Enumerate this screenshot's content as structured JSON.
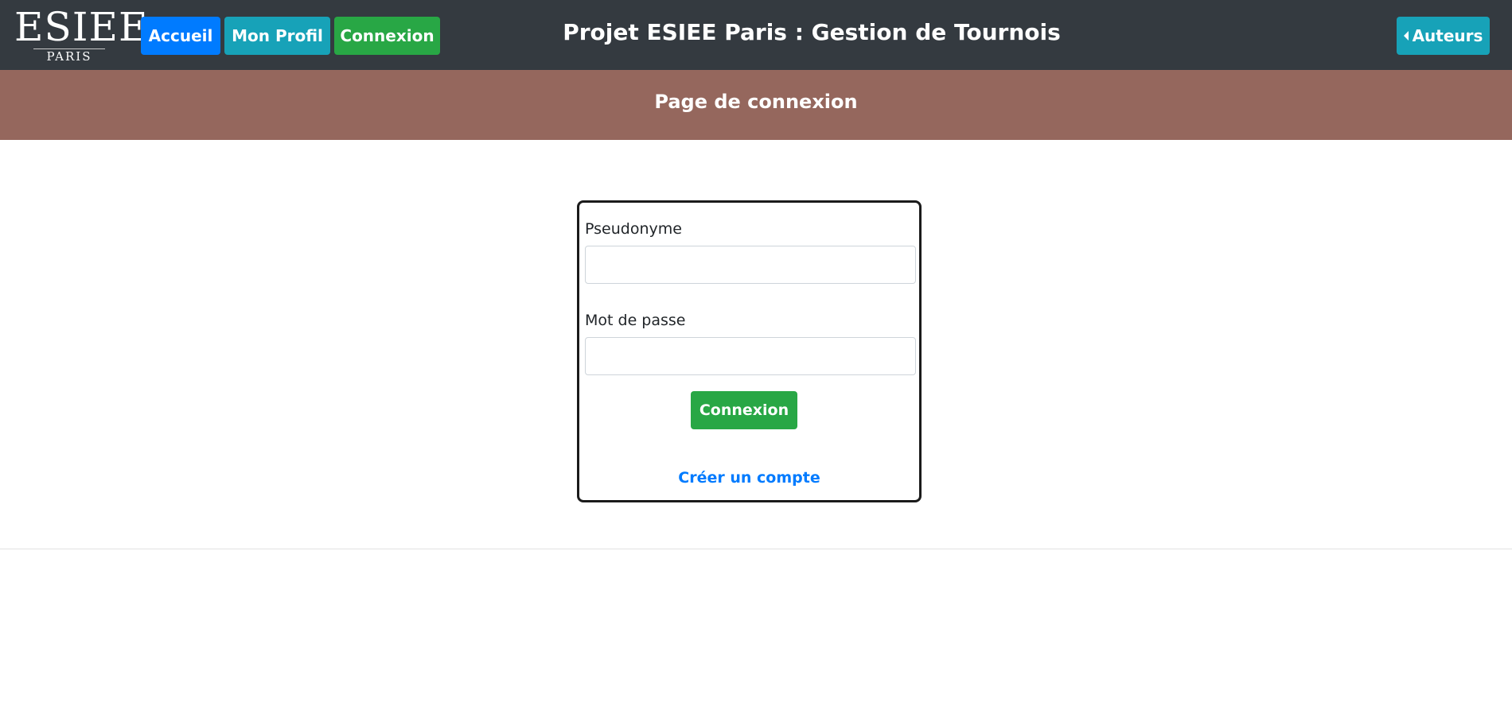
{
  "navbar": {
    "logo": {
      "main": "ESIEE",
      "sub": "PARIS"
    },
    "buttons": {
      "accueil": "Accueil",
      "profil": "Mon Profil",
      "connexion": "Connexion"
    },
    "title": "Projet ESIEE Paris : Gestion de Tournois",
    "auteurs_label": "Auteurs",
    "auteurs_icon": "caret-left-icon"
  },
  "banner": {
    "title": "Page de connexion"
  },
  "login_form": {
    "pseudo_label": "Pseudonyme",
    "pseudo_value": "",
    "password_label": "Mot de passe",
    "password_value": "",
    "submit_label": "Connexion",
    "create_account_link": "Créer un compte"
  },
  "colors": {
    "navbar_bg": "#343a40",
    "banner_bg": "#95675d",
    "primary": "#007bff",
    "info": "#17a2b8",
    "success": "#28a745"
  }
}
